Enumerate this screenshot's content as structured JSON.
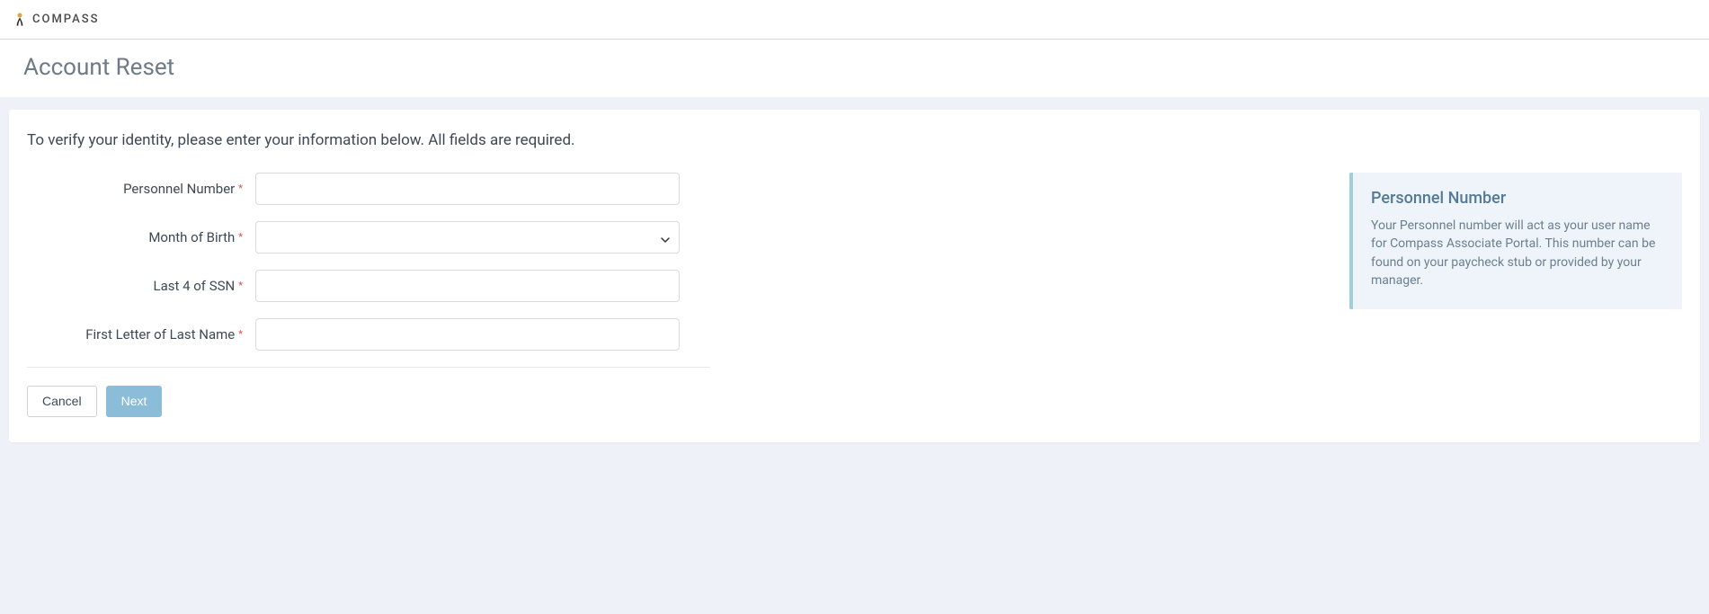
{
  "header": {
    "brand_text": "COMPASS"
  },
  "page": {
    "title": "Account Reset",
    "intro": "To verify your identity, please enter your information below. All fields are required."
  },
  "form": {
    "personnel_label": "Personnel Number",
    "personnel_value": "",
    "month_label": "Month of Birth",
    "month_value": "",
    "ssn_label": "Last 4 of SSN",
    "ssn_value": "",
    "lastname_label": "First Letter of Last Name",
    "lastname_value": ""
  },
  "buttons": {
    "cancel": "Cancel",
    "next": "Next"
  },
  "info": {
    "title": "Personnel Number",
    "body": "Your Personnel number will act as your user name for Compass Associate Portal. This number can be found on your paycheck stub or provided by your manager."
  }
}
